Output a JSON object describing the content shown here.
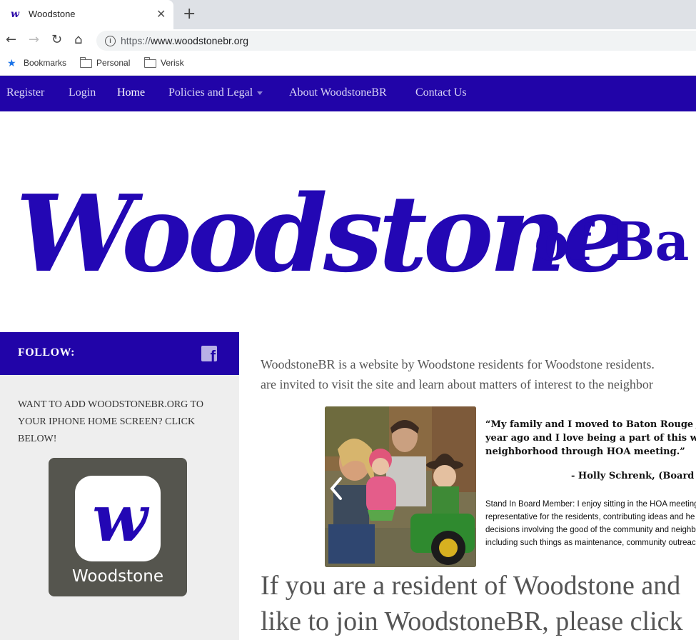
{
  "browser": {
    "tab_title": "Woodstone",
    "url_scheme": "https://",
    "url_host": "www.woodstonebr.org",
    "bookmarks": [
      {
        "label": "Bookmarks",
        "icon": "star-icon"
      },
      {
        "label": "Personal",
        "icon": "folder-icon"
      },
      {
        "label": "Verisk",
        "icon": "folder-icon"
      }
    ]
  },
  "nav": {
    "items": [
      "Register",
      "Login",
      "Home",
      "Policies and Legal",
      "About WoodstoneBR",
      "Contact Us"
    ],
    "active": "Home"
  },
  "logo": {
    "main": "Woodstone",
    "suffix": "of Ba"
  },
  "sidebar": {
    "follow_label": "FOLLOW:",
    "home_screen_text": "WANT TO ADD WOODSTONEBR.ORG TO YOUR IPHONE HOME SCREEN? CLICK BELOW!",
    "app_icon_letter": "w",
    "app_label": "Woodstone"
  },
  "main": {
    "intro_line1": "WoodstoneBR is a website by Woodstone residents for Woodstone residents.",
    "intro_line2": "are invited to visit the site and learn about matters of interest to the neighbor",
    "quote_lines": [
      "“My family and I moved to Baton Rouge ju",
      "year ago and I love being a part of this won",
      "neighborhood through HOA meeting.”"
    ],
    "attribution": "- Holly Schrenk, (Board M",
    "desc_lines": [
      "Stand In Board Member: I enjoy sitting in the HOA meeting",
      "representative for the residents, contributing ideas and he",
      "decisions involving the good of the community and neighb",
      "including such things as maintenance, community outreac"
    ],
    "cta_line1": "If you are a resident of Woodstone and",
    "cta_line2": "like to join WoodstoneBR, please click"
  },
  "colors": {
    "brand_purple": "#2104a8",
    "logo_purple": "#2307b4"
  }
}
